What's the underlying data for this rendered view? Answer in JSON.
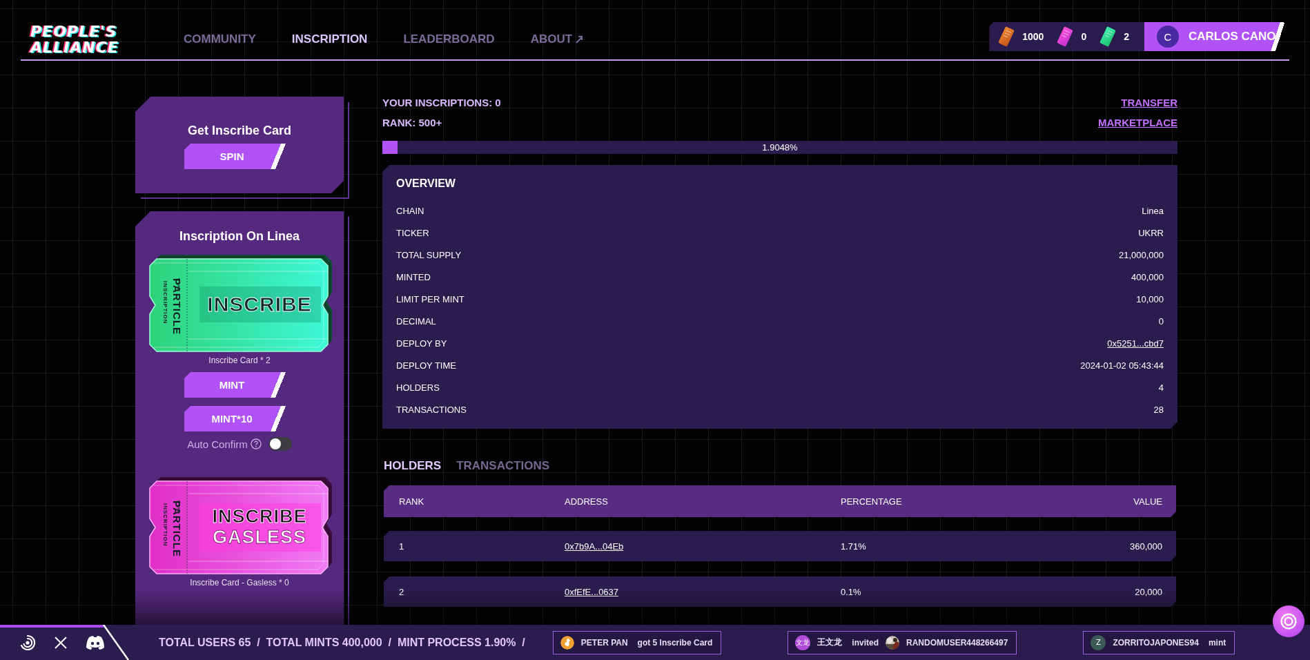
{
  "header": {
    "logo": [
      "PEOPLE'S",
      "ALLIANCE"
    ],
    "nav": [
      {
        "label": "COMMUNITY",
        "selected": false,
        "external": false
      },
      {
        "label": "INSCRIPTION",
        "selected": true,
        "external": false
      },
      {
        "label": "LEADERBOARD",
        "selected": false,
        "external": false
      },
      {
        "label": "ABOUT",
        "selected": false,
        "external": true
      }
    ],
    "balances": [
      {
        "kind": "point",
        "count": "1000"
      },
      {
        "kind": "gasless",
        "count": "0"
      },
      {
        "kind": "inscribe",
        "count": "2"
      }
    ],
    "user": {
      "initial": "C",
      "name": "CARLOS CANO"
    }
  },
  "spin_card": {
    "title": "Get Inscribe Card",
    "button": "SPIN"
  },
  "inscription_card": {
    "title": "Inscription On Linea",
    "tickets": [
      {
        "kind": "standard",
        "brand": "PARTICLE",
        "subtitle": "INSCRIPTION",
        "lines": [
          "INSCRIBE"
        ],
        "caption": "Inscribe Card * 2"
      },
      {
        "kind": "gasless",
        "brand": "PARTICLE",
        "subtitle": "INSCRIPTION",
        "lines": [
          "INSCRIBE",
          "GASLESS"
        ],
        "caption": "Inscribe Card - Gasless * 0"
      }
    ],
    "buttons": [
      "MINT",
      "MINT*10"
    ],
    "auto_confirm": {
      "label": "Auto Confirm",
      "on": false
    }
  },
  "stats": {
    "inscriptions": "YOUR INSCRIPTIONS: 0",
    "rank": "RANK: 500+",
    "links": [
      "TRANSFER",
      "MARKETPLACE"
    ]
  },
  "progress": {
    "level": 0.019048,
    "reading": "1.9048%"
  },
  "overview": {
    "title": "OVERVIEW",
    "rows": [
      {
        "label": "CHAIN",
        "value": "Linea",
        "link": false
      },
      {
        "label": "TICKER",
        "value": "UKRR",
        "link": false
      },
      {
        "label": "TOTAL SUPPLY",
        "value": "21,000,000",
        "link": false
      },
      {
        "label": "MINTED",
        "value": "400,000",
        "link": false
      },
      {
        "label": "LIMIT PER MINT",
        "value": "10,000",
        "link": false
      },
      {
        "label": "DECIMAL",
        "value": "0",
        "link": false
      },
      {
        "label": "DEPLOY BY",
        "value": "0x5251...cbd7",
        "link": true
      },
      {
        "label": "DEPLOY TIME",
        "value": "2024-01-02 05:43:44",
        "link": false
      },
      {
        "label": "HOLDERS",
        "value": "4",
        "link": false
      },
      {
        "label": "TRANSACTIONS",
        "value": "28",
        "link": false
      }
    ]
  },
  "tabs": [
    {
      "label": "HOLDERS",
      "selected": true
    },
    {
      "label": "TRANSACTIONS",
      "selected": false
    }
  ],
  "table": {
    "columns": [
      "RANK",
      "ADDRESS",
      "PERCENTAGE",
      "VALUE"
    ],
    "rows": [
      {
        "rank": "1",
        "address": "0x7b9A...04Eb",
        "percentage": "1.71%",
        "value": "360,000"
      },
      {
        "rank": "2",
        "address": "0xfEfE...0637",
        "percentage": "0.1%",
        "value": "20,000"
      }
    ]
  },
  "footer": {
    "stats": "TOTAL USERS 65  /  TOTAL MINTS 400,000  /  MINT PROCESS 1.90%  /",
    "activity": [
      {
        "user": "PETER PAN",
        "avatar": {
          "kind": "bird"
        },
        "action": "got 5 Inscribe Card"
      },
      {
        "user": "王文龙",
        "avatar": {
          "kind": "initials",
          "text": "文龙"
        },
        "action": "invited",
        "target": "RANDOMUSER448266497"
      },
      {
        "user": "ZORRITOJAPONES94",
        "avatar": {
          "kind": "initials",
          "text": "Z"
        },
        "action": "mint"
      }
    ]
  }
}
